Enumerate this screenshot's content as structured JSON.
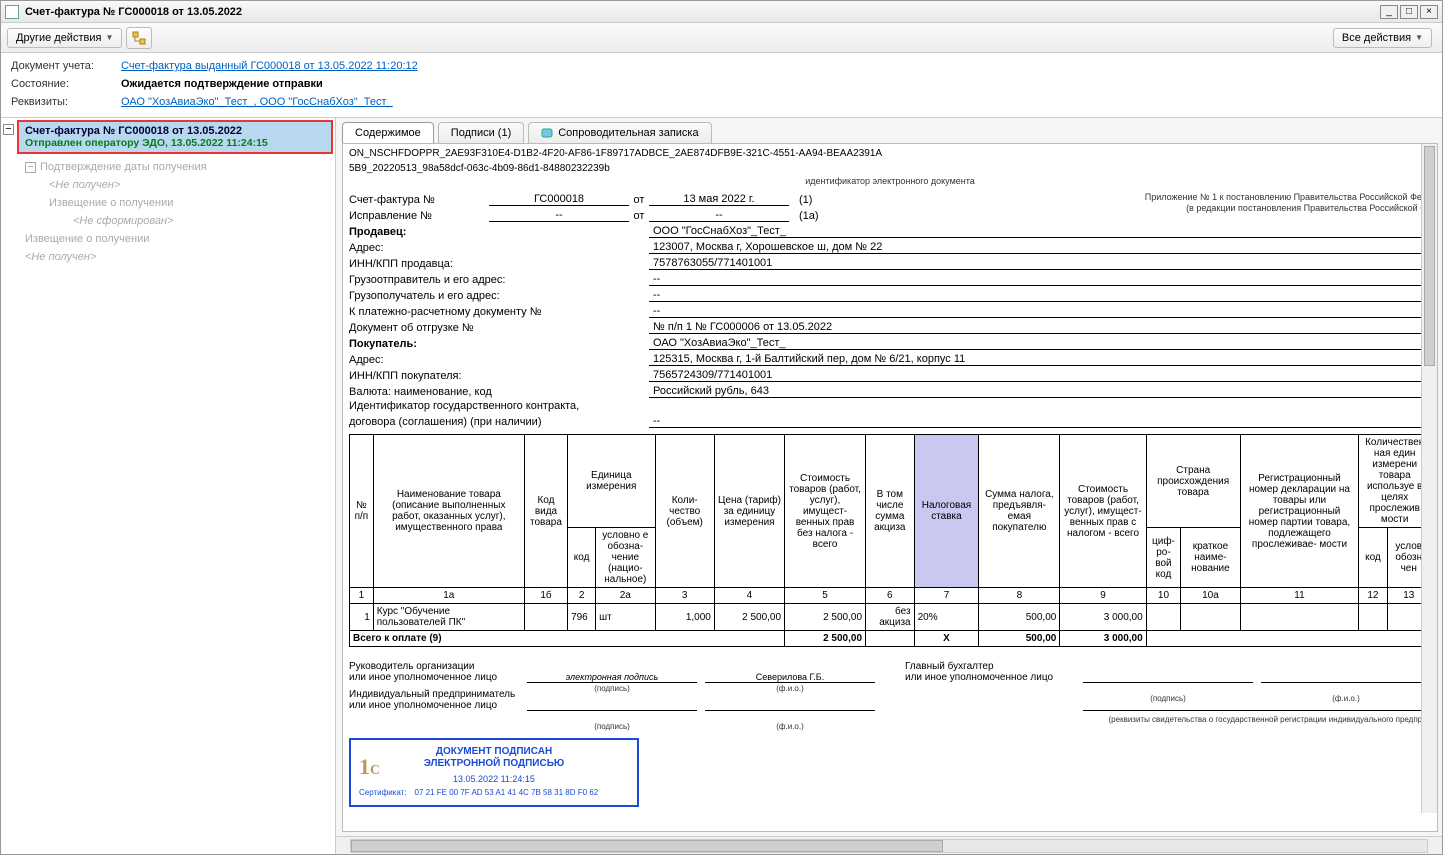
{
  "window": {
    "title": "Счет-фактура № ГС000018 от 13.05.2022"
  },
  "toolbar": {
    "other_actions": "Другие действия",
    "all_actions": "Все действия"
  },
  "header": {
    "doc_label": "Документ учета:",
    "doc_link": "Счет-фактура выданный ГС000018 от 13.05.2022 11:20:12",
    "state_label": "Состояние:",
    "state_value": "Ожидается подтверждение отправки",
    "req_label": "Реквизиты:",
    "req_link": "ОАО \"ХозАвиаЭко\"_Тест_, ООО \"ГосСнабХоз\"_Тест_"
  },
  "tree": {
    "node_title": "Счет-фактура № ГС000018 от 13.05.2022",
    "node_status": "Отправлен оператору ЭДО, 13.05.2022 11:24:15",
    "sub1": "Подтверждение даты получения",
    "sub1s": "<Не получен>",
    "sub2": "Извещение о получении",
    "sub2s": "<Не сформирован>",
    "sub3": "Извещение о получении",
    "sub3s": "<Не получен>"
  },
  "tabs": {
    "t1": "Содержимое",
    "t2": "Подписи (1)",
    "t3": "Сопроводительная записка"
  },
  "doc": {
    "id1": "ON_NSCHFDOPPR_2AE93F310E4-D1B2-4F20-AF86-1F89717ADBCE_2AE874DFB9E-321C-4551-AA94-BEAA2391A",
    "id2": "5B9_20220513_98a58dcf-063c-4b09-86d1-84880232239b",
    "idcap": "идентификатор электронного документа",
    "app1": "Приложение № 1 к постановлению Правительства Российской Фед",
    "app2": "(в редакции постановления Правительства Российской Ф",
    "f_num_l": "Счет-фактура №",
    "f_num_v": "ГС000018",
    "f_ot": "от",
    "f_date": "13 мая 2022 г.",
    "f_p1": "(1)",
    "f_isp_l": "Исправление №",
    "f_isp_v": "--",
    "f_isp_d": "--",
    "f_p1a": "(1а)",
    "f_seller_l": "Продавец:",
    "f_seller_v": "ООО \"ГосСнабХоз\"_Тест_",
    "f_addr_l": "Адрес:",
    "f_addr_v": "123007, Москва г, Хорошевское ш, дом № 22",
    "f_inn_l": "ИНН/КПП продавца:",
    "f_inn_v": "7578763055/771401001",
    "f_gruz_l": "Грузоотправитель и его адрес:",
    "f_gruz_v": "--",
    "f_gruzp_l": "Грузополучатель и его адрес:",
    "f_gruzp_v": "--",
    "f_plat_l": "К платежно-расчетному документу №",
    "f_plat_v": "--",
    "f_ship_l": "Документ об отгрузке №",
    "f_ship_v": "№ п/п 1 № ГС000006 от 13.05.2022",
    "f_buyer_l": "Покупатель:",
    "f_buyer_v": "ОАО \"ХозАвиаЭко\"_Тест_",
    "f_baddr_l": "Адрес:",
    "f_baddr_v": "125315, Москва г, 1-й Балтийский пер, дом № 6/21, корпус 11",
    "f_binn_l": "ИНН/КПП покупателя:",
    "f_binn_v": "7565724309/771401001",
    "f_cur_l": "Валюта: наименование, код",
    "f_cur_v": "Российский рубль, 643",
    "f_gos_l1": "Идентификатор государственного контракта,",
    "f_gos_l2": "договора (соглашения) (при наличии)",
    "f_gos_v": "--"
  },
  "cols": {
    "c_np": "№ п/п",
    "c_name": "Наименование товара (описание выполненных работ, оказанных услуг), имущественного права",
    "c_kvt": "Код вида товара",
    "c_unit": "Единица измерения",
    "c_unit_k": "код",
    "c_unit_n": "условно е обозна- чение (нацио- нальное)",
    "c_qty": "Коли- чество (объем)",
    "c_price": "Цена (тариф) за единицу измерения",
    "c_sum": "Стоимость товаров (работ, услуг), имущест- венных прав без налога - всего",
    "c_akc": "В том числе сумма акциза",
    "c_rate": "Налоговая ставка",
    "c_tax": "Сумма налога, предъявля- емая покупателю",
    "c_sumt": "Стоимость товаров (работ, услуг), имущест- венных прав с налогом - всего",
    "c_ctry": "Страна происхождения товара",
    "c_ctry_k": "циф- ро- вой код",
    "c_ctry_n": "краткое наиме- нование",
    "c_reg": "Регистрационный номер декларации на товары или регистрационный номер партии товара, подлежащего прослеживае- мости",
    "c_kod2": "код",
    "c_extra1": "Количествен ная един измерени товара используе в целях прослежив мости",
    "c_extra2": "услов обозн чен"
  },
  "colnums": {
    "n1": "1",
    "n1a": "1а",
    "n1b": "1б",
    "n2": "2",
    "n2a": "2а",
    "n3": "3",
    "n4": "4",
    "n5": "5",
    "n6": "6",
    "n7": "7",
    "n8": "8",
    "n9": "9",
    "n10": "10",
    "n10a": "10а",
    "n11": "11",
    "n12": "12",
    "n13": "13"
  },
  "row1": {
    "np": "1",
    "name": "Курс \"Обучение пользователей ПК\"",
    "kvt": "",
    "uk": "796",
    "un": "шт",
    "qty": "1,000",
    "price": "2 500,00",
    "sum": "2 500,00",
    "akc": "без акциза",
    "rate": "20%",
    "tax": "500,00",
    "sumt": "3 000,00",
    "ck": "",
    "cn": "",
    "reg": ""
  },
  "total": {
    "label": "Всего к оплате (9)",
    "sum": "2 500,00",
    "rate": "X",
    "tax": "500,00",
    "sumt": "3 000,00"
  },
  "sign": {
    "ruk_l1": "Руководитель организации",
    "ruk_l2": "или иное уполномоченное лицо",
    "ep": "электронная подпись",
    "fio": "Северилова Г.Б.",
    "podpis": "(подпись)",
    "fio_u": "(ф.и.о.)",
    "glav_l1": "Главный бухгалтер",
    "glav_l2": "или иное уполномоченное лицо",
    "ip_l1": "Индивидуальный предприниматель",
    "ip_l2": "или иное уполномоченное лицо",
    "rekv": "(реквизиты свидетельства о государственной регистрации индивидуального предприн"
  },
  "stamp": {
    "h1": "ДОКУМЕНТ ПОДПИСАН",
    "h2": "ЭЛЕКТРОННОЙ ПОДПИСЬЮ",
    "dt": "13.05.2022 11:24:15",
    "cert_l": "Сертификат:",
    "cert_v": "07 21 FE 00 7F AD 53 A1 41 4C 7B 58 31 8D F0 62"
  }
}
